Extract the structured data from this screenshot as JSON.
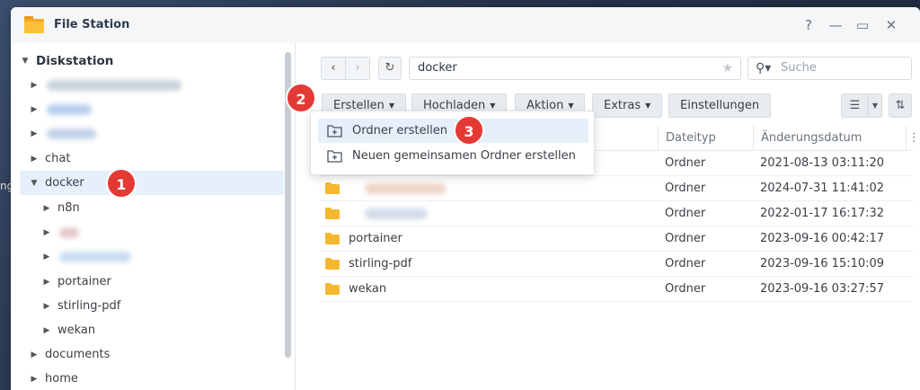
{
  "window": {
    "title": "File Station"
  },
  "bg_text": "ng",
  "window_controls": {
    "help": "?",
    "minimize": "—",
    "maximize": "▭",
    "close": "✕"
  },
  "sidebar": {
    "root": "Diskstation",
    "items": [
      {
        "label": "chat"
      },
      {
        "label": "docker",
        "badge": "1"
      },
      {
        "label": "n8n"
      },
      {
        "label": "portainer"
      },
      {
        "label": "stirling-pdf"
      },
      {
        "label": "wekan"
      },
      {
        "label": "documents"
      },
      {
        "label": "home"
      }
    ]
  },
  "nav": {
    "back": "‹",
    "forward": "›",
    "refresh": "↻"
  },
  "path": {
    "value": "docker"
  },
  "search": {
    "placeholder": "Suche"
  },
  "toolbar": {
    "create": "Erstellen",
    "create_badge": "2",
    "upload": "Hochladen",
    "action": "Aktion",
    "extras": "Extras",
    "settings": "Einstellungen"
  },
  "create_menu": {
    "items": [
      {
        "label": "Ordner erstellen",
        "badge": "3"
      },
      {
        "label": "Neuen gemeinsamen Ordner erstellen"
      }
    ]
  },
  "table": {
    "columns": {
      "type": "Dateityp",
      "modified": "Änderungsdatum"
    },
    "rows": [
      {
        "name": "",
        "type": "Ordner",
        "modified": "2021-08-13 03:11:20"
      },
      {
        "name": "",
        "type": "Ordner",
        "modified": "2024-07-31 11:41:02"
      },
      {
        "name": "",
        "type": "Ordner",
        "modified": "2022-01-17 16:17:32"
      },
      {
        "name": "portainer",
        "type": "Ordner",
        "modified": "2023-09-16 00:42:17"
      },
      {
        "name": "stirling-pdf",
        "type": "Ordner",
        "modified": "2023-09-16 15:10:09"
      },
      {
        "name": "wekan",
        "type": "Ordner",
        "modified": "2023-09-16 03:27:57"
      }
    ]
  },
  "colors": {
    "accent_red": "#e53935",
    "selection": "#e6f0fb",
    "folder": "#f5b82e"
  }
}
